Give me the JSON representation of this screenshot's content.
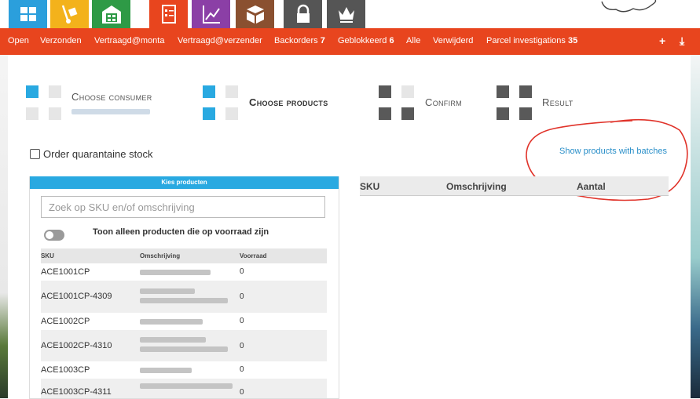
{
  "nav": {
    "items": [
      {
        "label": "Open"
      },
      {
        "label": "Verzonden"
      },
      {
        "label": "Vertraagd@monta"
      },
      {
        "label": "Vertraagd@verzender"
      },
      {
        "label": "Backorders",
        "count": "7"
      },
      {
        "label": "Geblokkeerd",
        "count": "6"
      },
      {
        "label": "Alle"
      },
      {
        "label": "Verwijderd"
      },
      {
        "label": "Parcel investigations",
        "count": "35"
      }
    ],
    "add_icon": "+",
    "export_icon": "⤓"
  },
  "top_icons": [
    {
      "name": "grid-icon",
      "color": "#2b9fdc"
    },
    {
      "name": "hand-truck-icon",
      "color": "#f3b21b"
    },
    {
      "name": "warehouse-icon",
      "color": "#2e9a46"
    },
    {
      "name": "checklist-icon",
      "color": "#e8451e"
    },
    {
      "name": "chart-icon",
      "color": "#8b3fa6"
    },
    {
      "name": "box-icon",
      "color": "#8a5030"
    },
    {
      "name": "lock-icon",
      "color": "#555555"
    },
    {
      "name": "crown-icon",
      "color": "#555555"
    }
  ],
  "wizard": {
    "steps": [
      {
        "label": "Choose consumer",
        "state": "done"
      },
      {
        "label": "Choose products",
        "state": "active"
      },
      {
        "label": "Confirm",
        "state": "pending"
      },
      {
        "label": "Result",
        "state": "pending"
      }
    ]
  },
  "options": {
    "quarantine_label": "Order quarantaine stock",
    "batches_link": "Show products with batches"
  },
  "product_panel": {
    "title": "Kies producten",
    "search_placeholder": "Zoek op SKU en/of omschrijving",
    "stock_toggle_label": "Toon alleen producten die op voorraad zijn",
    "columns": [
      "SKU",
      "Omschrijving",
      "Voorraad"
    ],
    "rows": [
      {
        "sku": "ACE1001CP",
        "stock": "0"
      },
      {
        "sku": "ACE1001CP-4309",
        "stock": "0"
      },
      {
        "sku": "ACE1002CP",
        "stock": "0"
      },
      {
        "sku": "ACE1002CP-4310",
        "stock": "0"
      },
      {
        "sku": "ACE1003CP",
        "stock": "0"
      },
      {
        "sku": "ACE1003CP-4311",
        "stock": "0"
      }
    ]
  },
  "summary_table": {
    "columns": [
      "SKU",
      "Omschrijving",
      "Aantal"
    ]
  },
  "colors": {
    "accent": "#e8451e",
    "primary": "#29a9e1",
    "annotation": "#e0332a"
  }
}
